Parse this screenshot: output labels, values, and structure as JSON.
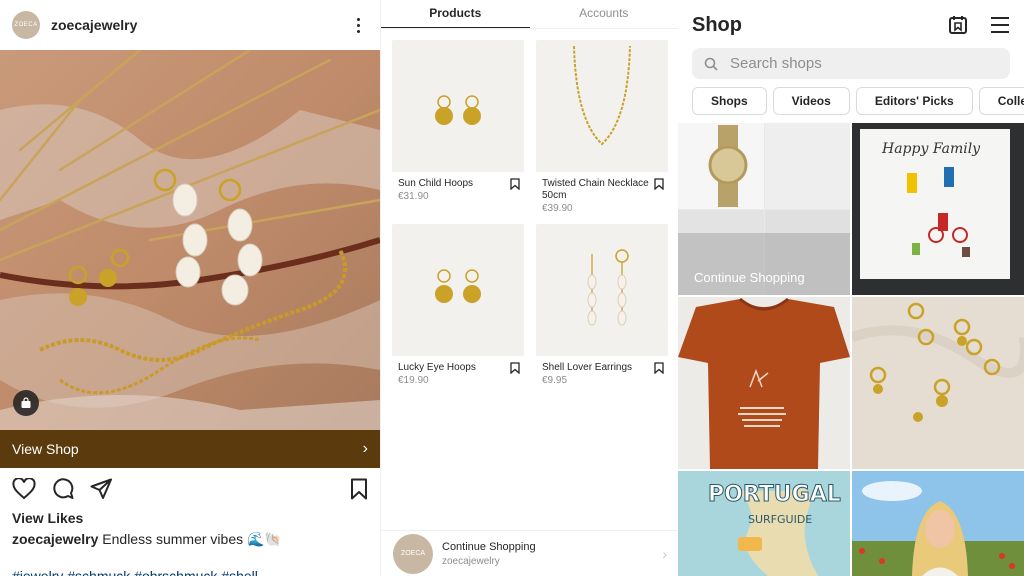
{
  "post": {
    "username": "zoecajewelry",
    "avatar_text": "ZOECA",
    "view_shop": "View Shop",
    "view_likes": "View Likes",
    "caption_user": "zoecajewelry",
    "caption_text": "Endless summer vibes 🌊🐚",
    "hashtags": "#jewelry #schmuck #ohrschmuck #shell"
  },
  "products_panel": {
    "tabs": [
      "Products",
      "Accounts"
    ],
    "products": [
      {
        "name": "Sun Child Hoops",
        "price": "€31.90"
      },
      {
        "name": "Twisted Chain Necklace 50cm",
        "price": "€39.90"
      },
      {
        "name": "Lucky Eye Hoops",
        "price": "€19.90"
      },
      {
        "name": "Shell Lover Earrings",
        "price": "€9.95"
      }
    ],
    "continue": {
      "title": "Continue Shopping",
      "subtitle": "zoecajewelry",
      "avatar_text": "ZOECA"
    }
  },
  "shop": {
    "title": "Shop",
    "search_placeholder": "Search shops",
    "chips": [
      "Shops",
      "Videos",
      "Editors' Picks",
      "Collections"
    ],
    "continue_label": "Continue Shopping",
    "tile_icons": [
      "watch-image",
      "happy-family-frame-image",
      "orange-tshirt-image",
      "earrings-flatlay-image",
      "portugal-surfguide-image",
      "woman-field-image"
    ]
  },
  "colors": {
    "view_shop_bar": "#5b3b0d",
    "hashtag": "#00376b",
    "gold": "#c9a227"
  }
}
